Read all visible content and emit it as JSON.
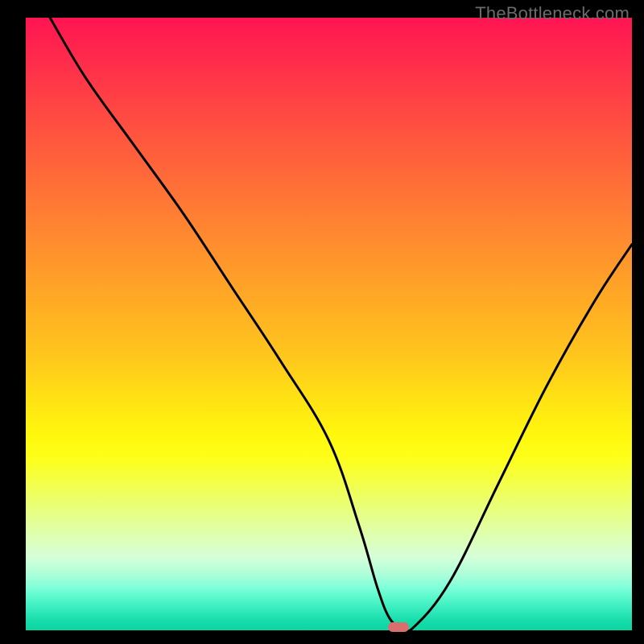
{
  "watermark": "TheBottleneck.com",
  "colors": {
    "frame": "#000000",
    "pill": "#d96e6e",
    "curve": "#000000"
  },
  "chart_data": {
    "type": "line",
    "title": "",
    "xlabel": "",
    "ylabel": "",
    "xlim": [
      0,
      100
    ],
    "ylim": [
      0,
      100
    ],
    "grid": false,
    "legend": false,
    "background_gradient": {
      "top": "red",
      "middle": "yellow",
      "bottom": "green"
    },
    "series": [
      {
        "name": "bottleneck-curve",
        "x": [
          4,
          10,
          18,
          26,
          34,
          42,
          50,
          55,
          58,
          60,
          62,
          64,
          70,
          78,
          86,
          94,
          100
        ],
        "y": [
          100,
          90,
          79,
          68,
          56,
          44,
          31,
          17,
          7,
          2,
          0.5,
          0.5,
          8,
          24,
          40,
          54,
          63
        ]
      }
    ],
    "marker": {
      "name": "optimal-point",
      "x": 61.5,
      "y": 0.5,
      "shape": "pill",
      "color": "#d96e6e"
    }
  }
}
